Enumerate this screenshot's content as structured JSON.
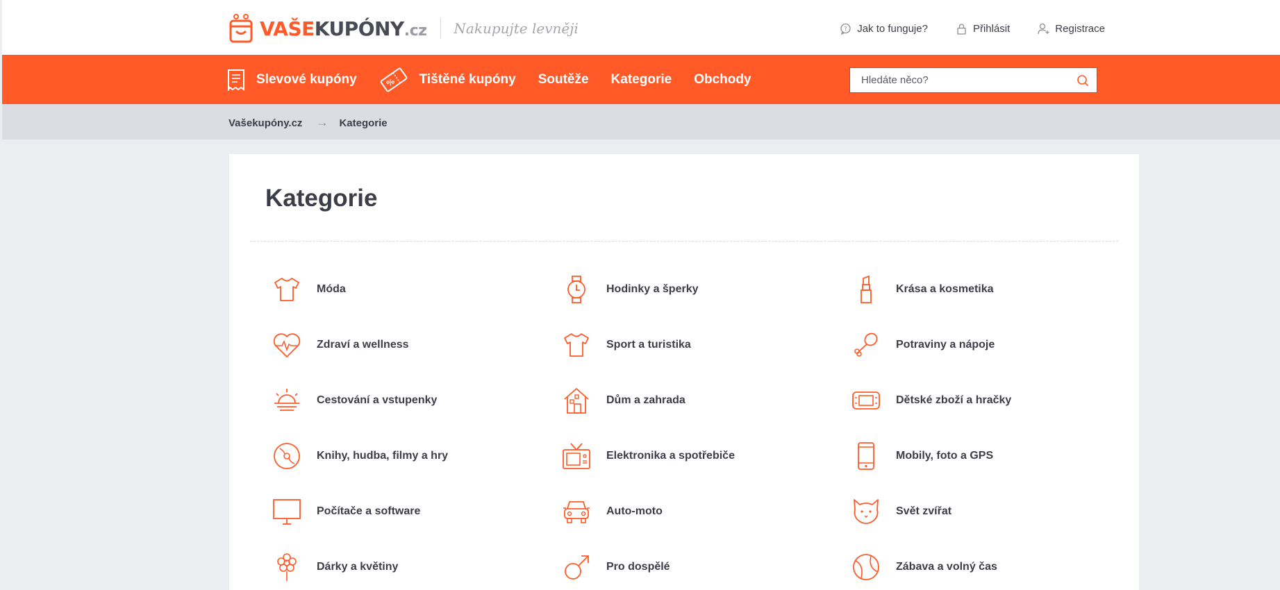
{
  "brand": {
    "logo_a": "VAŠE",
    "logo_b": "KUPÓNY",
    "logo_c": ".cz",
    "tagline": "Nakupujte levněji"
  },
  "toplinks": {
    "how": "Jak to funguje?",
    "login": "Přihlásit",
    "register": "Registrace"
  },
  "nav": {
    "items": [
      {
        "label": "Slevové kupóny",
        "icon": "receipt-icon"
      },
      {
        "label": "Tištěné kupóny",
        "icon": "coupon-icon"
      },
      {
        "label": "Soutěže"
      },
      {
        "label": "Kategorie"
      },
      {
        "label": "Obchody"
      }
    ],
    "search_placeholder": "Hledáte něco?"
  },
  "breadcrumb": {
    "home": "Vašekupóny.cz",
    "current": "Kategorie"
  },
  "page": {
    "title": "Kategorie"
  },
  "categories": [
    {
      "label": "Móda",
      "icon": "tshirt-icon"
    },
    {
      "label": "Hodinky a šperky",
      "icon": "watch-icon"
    },
    {
      "label": "Krása a kosmetika",
      "icon": "lipstick-icon"
    },
    {
      "label": "Zdraví a wellness",
      "icon": "heart-pulse-icon"
    },
    {
      "label": "Sport a turistika",
      "icon": "jersey-icon"
    },
    {
      "label": "Potraviny a nápoje",
      "icon": "drumstick-icon"
    },
    {
      "label": "Cestování a vstupenky",
      "icon": "sunset-icon"
    },
    {
      "label": "Dům a zahrada",
      "icon": "house-icon"
    },
    {
      "label": "Dětské zboží a hračky",
      "icon": "game-console-icon"
    },
    {
      "label": "Knihy, hudba, filmy a hry",
      "icon": "disc-icon"
    },
    {
      "label": "Elektronika a spotřebiče",
      "icon": "tv-icon"
    },
    {
      "label": "Mobily, foto a GPS",
      "icon": "phone-icon"
    },
    {
      "label": "Počítače a software",
      "icon": "monitor-icon"
    },
    {
      "label": "Auto-moto",
      "icon": "car-icon"
    },
    {
      "label": "Svět zvířat",
      "icon": "cat-icon"
    },
    {
      "label": "Dárky a květiny",
      "icon": "flower-icon"
    },
    {
      "label": "Pro dospělé",
      "icon": "male-symbol-icon"
    },
    {
      "label": "Zábava a volný čas",
      "icon": "ball-icon"
    }
  ],
  "colors": {
    "accent": "#ff5a27",
    "text": "#3d3d4a",
    "background": "#ecedf1"
  }
}
